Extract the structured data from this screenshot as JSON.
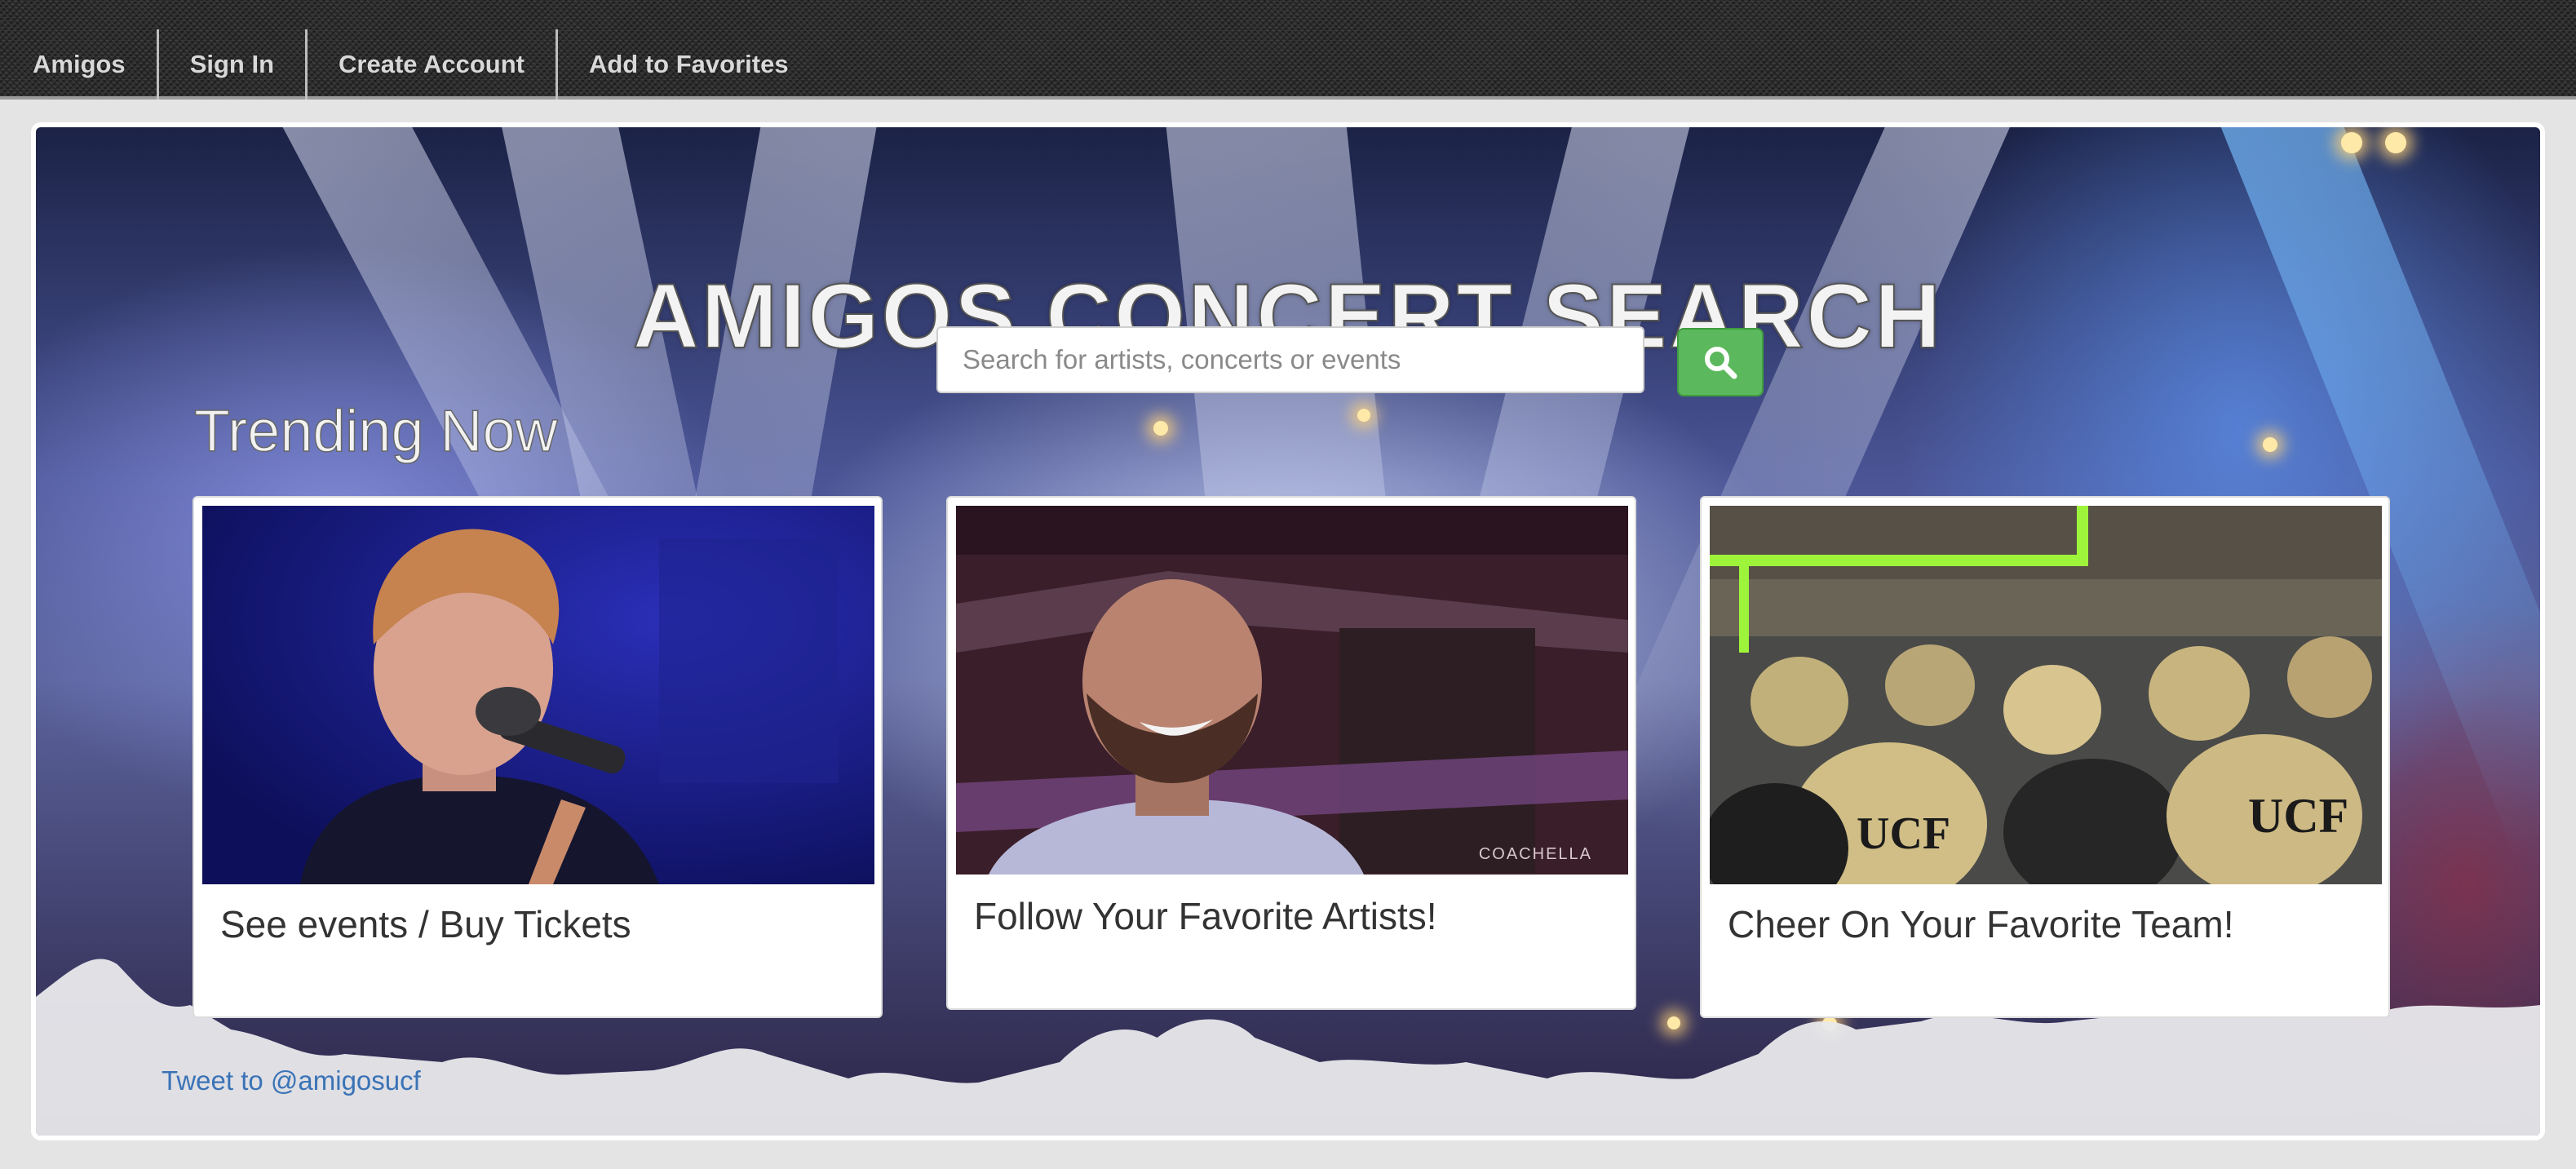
{
  "nav": {
    "items": [
      {
        "label": "Amigos"
      },
      {
        "label": "Sign In"
      },
      {
        "label": "Create Account"
      },
      {
        "label": "Add to Favorites"
      }
    ]
  },
  "hero": {
    "title": "AMIGOS CONCERT SEARCH",
    "search": {
      "placeholder": "Search for artists, concerts or events",
      "value": "",
      "button_icon": "search-icon",
      "button_color": "#5cb85c"
    },
    "section_title": "Trending Now"
  },
  "cards": [
    {
      "caption": "See events / Buy Tickets",
      "image": "singer-with-microphone-photo"
    },
    {
      "caption": "Follow Your Favorite Artists!",
      "image": "smiling-performer-photo",
      "watermark": "COACHELLA"
    },
    {
      "caption": "Cheer On Your Favorite Team!",
      "image": "football-team-huddle-photo"
    }
  ],
  "footer": {
    "tweet_link": "Tweet to @amigosucf"
  },
  "colors": {
    "link": "#3a73b6",
    "search_button": "#5cb85c"
  }
}
